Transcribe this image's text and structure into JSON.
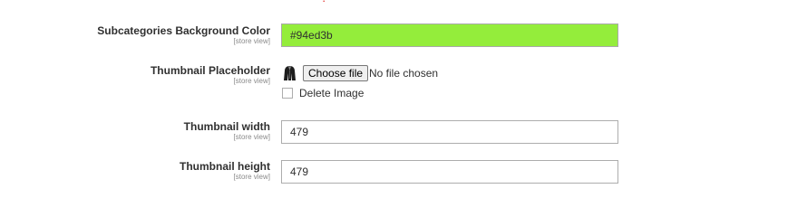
{
  "top_error": {
    "text": "• • ,"
  },
  "fields": {
    "subcategories_bg_color": {
      "label": "Subcategories Background Color",
      "scope": "[store view]",
      "value": "#94ed3b"
    },
    "thumbnail_placeholder": {
      "label": "Thumbnail Placeholder",
      "scope": "[store view]",
      "choose_file_label": "Choose file",
      "file_status": "No file chosen",
      "delete_label": "Delete Image",
      "delete_checked": false,
      "thumbnail_icon": "thumbnail-image-icon"
    },
    "thumbnail_width": {
      "label": "Thumbnail width",
      "scope": "[store view]",
      "value": "479"
    },
    "thumbnail_height": {
      "label": "Thumbnail height",
      "scope": "[store view]",
      "value": "479"
    }
  },
  "colors": {
    "color_input_bg": "#94ed3b",
    "error_text": "#e02b27"
  }
}
